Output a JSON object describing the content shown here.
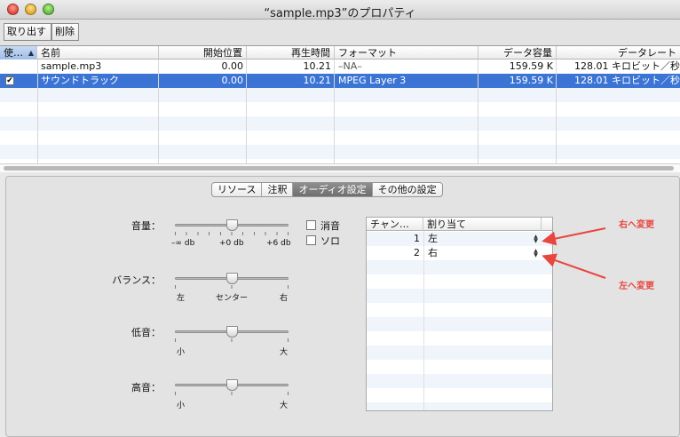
{
  "window": {
    "title": "“sample.mp3”のプロパティ"
  },
  "toolbar": {
    "extract": "取り出す",
    "delete": "削除"
  },
  "table": {
    "columns": [
      "使…",
      "名前",
      "開始位置",
      "再生時間",
      "フォーマット",
      "データ容量",
      "データレート"
    ],
    "rows": [
      {
        "checked": false,
        "name": "sample.mp3",
        "start": "0.00",
        "duration": "10.21",
        "format": "–NA–",
        "size": "159.59 K",
        "rate": "128.01 キロビット／秒"
      },
      {
        "checked": true,
        "name": "サウンドトラック",
        "start": "0.00",
        "duration": "10.21",
        "format": "MPEG Layer 3",
        "size": "159.59 K",
        "rate": "128.01 キロビット／秒"
      }
    ]
  },
  "tabs": [
    "リソース",
    "注釈",
    "オーディオ設定",
    "その他の設定"
  ],
  "activeTab": 2,
  "audio": {
    "volume": {
      "label": "音量：",
      "value": 0.5,
      "min": "–∞ db",
      "mid": "+0 db",
      "max": "+6 db"
    },
    "balance": {
      "label": "バランス：",
      "value": 0.5,
      "min": "左",
      "mid": "センター",
      "max": "右"
    },
    "bass": {
      "label": "低音：",
      "value": 0.5,
      "min": "小",
      "max": "大"
    },
    "treble": {
      "label": "高音：",
      "value": 0.5,
      "min": "小",
      "max": "大"
    },
    "mute": {
      "label": "消音",
      "checked": false
    },
    "solo": {
      "label": "ソロ",
      "checked": false
    }
  },
  "channels": {
    "columns": [
      "チャン…",
      "割り当て"
    ],
    "rows": [
      {
        "num": "1",
        "assign": "左"
      },
      {
        "num": "2",
        "assign": "右"
      }
    ]
  },
  "annotations": {
    "top": "右へ変更",
    "bottom": "左へ変更",
    "color": "#e8463f"
  }
}
